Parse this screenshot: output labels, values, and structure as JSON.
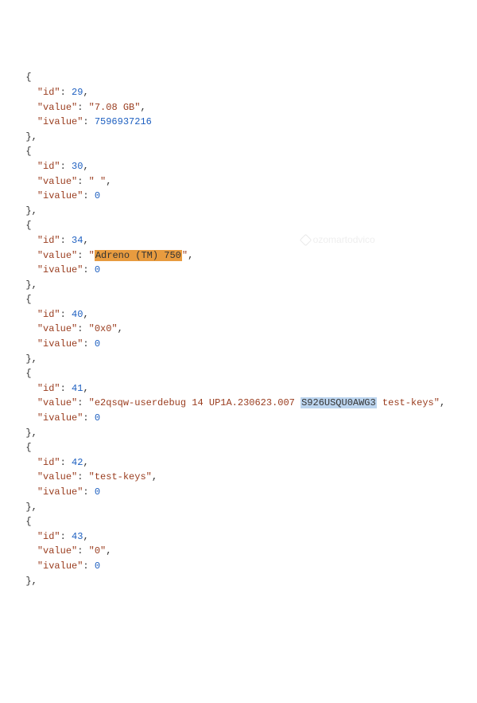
{
  "indent1": "  ",
  "indent2": "    ",
  "brace_open": "{",
  "brace_close_comma": "},",
  "keys": {
    "id": "\"id\"",
    "value": "\"value\"",
    "ivalue": "\"ivalue\""
  },
  "colon": ": ",
  "comma": ",",
  "items": [
    {
      "id": "29",
      "value_pre": "\"7.08 GB\"",
      "value_hl": "",
      "value_post": "",
      "hl_class": "",
      "ivalue": "7596937216"
    },
    {
      "id": "30",
      "value_pre": "\" \"",
      "value_hl": "",
      "value_post": "",
      "hl_class": "",
      "ivalue": "0"
    },
    {
      "id": "34",
      "value_pre": "\"",
      "value_hl": "Adreno (TM) 750",
      "value_post": "\"",
      "hl_class": "hl-orange",
      "ivalue": "0"
    },
    {
      "id": "40",
      "value_pre": "\"0x0\"",
      "value_hl": "",
      "value_post": "",
      "hl_class": "",
      "ivalue": "0"
    },
    {
      "id": "41",
      "value_pre": "\"e2qsqw-userdebug 14 UP1A.230623.007 ",
      "value_hl": "S926USQU0AWG3",
      "value_post": " test-keys\"",
      "hl_class": "hl-blue",
      "ivalue": "0"
    },
    {
      "id": "42",
      "value_pre": "\"test-keys\"",
      "value_hl": "",
      "value_post": "",
      "hl_class": "",
      "ivalue": "0"
    },
    {
      "id": "43",
      "value_pre": "\"0\"",
      "value_hl": "",
      "value_post": "",
      "hl_class": "",
      "ivalue": "0"
    }
  ],
  "watermark": "ozomartodvico"
}
